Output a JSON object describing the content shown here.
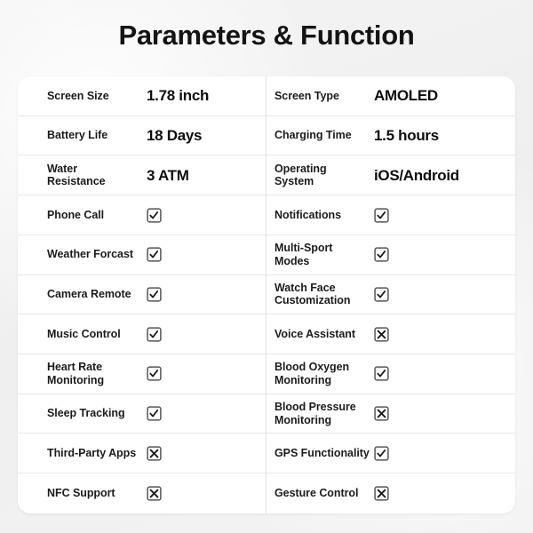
{
  "title": "Parameters & Function",
  "icons": {
    "check": "checkbox-checked-icon",
    "cross": "checkbox-crossed-icon"
  },
  "colors": {
    "background": "#f2f2f2",
    "card": "#ffffff",
    "text": "#141414",
    "divider": "#e6e6e6",
    "mark": "#555555"
  },
  "table": {
    "left_column": [
      {
        "label": "Screen Size",
        "type": "value",
        "value": "1.78 inch"
      },
      {
        "label": "Battery Life",
        "type": "value",
        "value": "18 Days"
      },
      {
        "label": "Water\nResistance",
        "type": "value",
        "value": "3 ATM"
      },
      {
        "label": "Phone Call",
        "type": "mark",
        "mark": "check"
      },
      {
        "label": "Weather Forcast",
        "type": "mark",
        "mark": "check"
      },
      {
        "label": "Camera Remote",
        "type": "mark",
        "mark": "check"
      },
      {
        "label": "Music Control",
        "type": "mark",
        "mark": "check"
      },
      {
        "label": "Heart Rate\nMonitoring",
        "type": "mark",
        "mark": "check"
      },
      {
        "label": "Sleep Tracking",
        "type": "mark",
        "mark": "check"
      },
      {
        "label": "Third-Party Apps",
        "type": "mark",
        "mark": "cross"
      },
      {
        "label": "NFC Support",
        "type": "mark",
        "mark": "cross"
      }
    ],
    "right_column": [
      {
        "label": "Screen Type",
        "type": "value",
        "value": "AMOLED"
      },
      {
        "label": "Charging Time",
        "type": "value",
        "value": "1.5 hours"
      },
      {
        "label": "Operating\nSystem",
        "type": "value",
        "value": "iOS/Android"
      },
      {
        "label": "Notifications",
        "type": "mark",
        "mark": "check"
      },
      {
        "label": "Multi-Sport\nModes",
        "type": "mark",
        "mark": "check"
      },
      {
        "label": "Watch Face\nCustomization",
        "type": "mark",
        "mark": "check"
      },
      {
        "label": "Voice Assistant",
        "type": "mark",
        "mark": "cross"
      },
      {
        "label": "Blood Oxygen\nMonitoring",
        "type": "mark",
        "mark": "check"
      },
      {
        "label": "Blood Pressure\nMonitoring",
        "type": "mark",
        "mark": "cross"
      },
      {
        "label": "GPS Functionality",
        "type": "mark",
        "mark": "check"
      },
      {
        "label": "Gesture Control",
        "type": "mark",
        "mark": "cross"
      }
    ]
  }
}
